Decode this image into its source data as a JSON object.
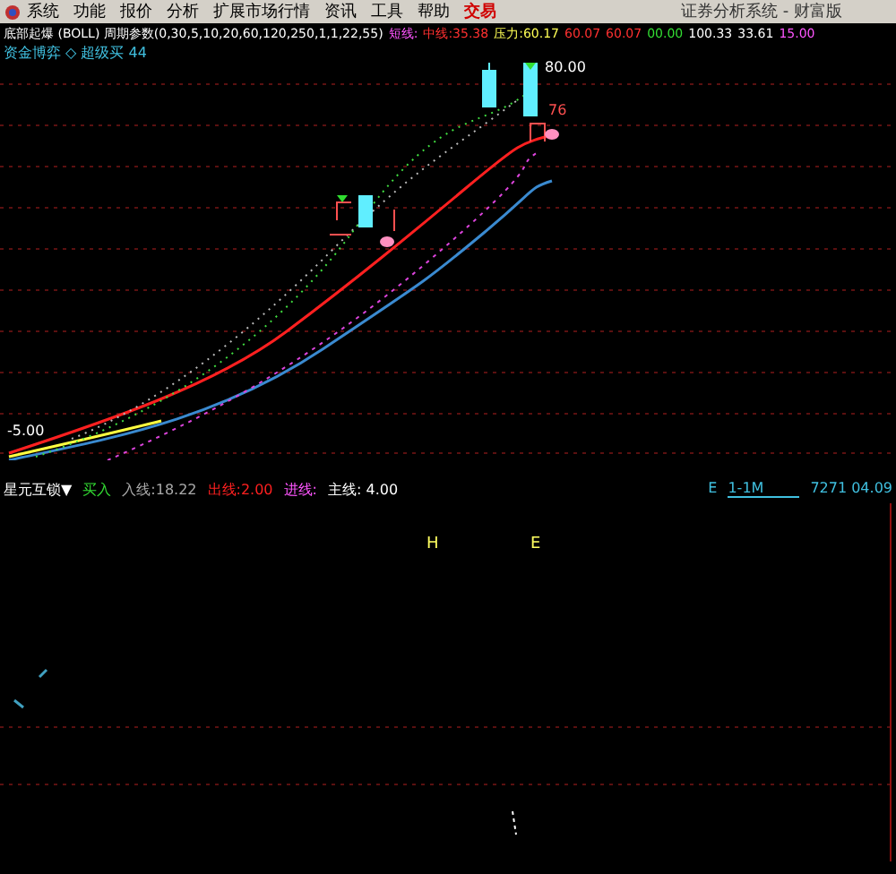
{
  "menu": {
    "items": [
      {
        "label": "系统",
        "highlight": false
      },
      {
        "label": "功能",
        "highlight": false
      },
      {
        "label": "报价",
        "highlight": false
      },
      {
        "label": "分析",
        "highlight": false
      },
      {
        "label": "扩展市场行情",
        "highlight": false
      },
      {
        "label": "资讯",
        "highlight": false
      },
      {
        "label": "工具",
        "highlight": false
      },
      {
        "label": "帮助",
        "highlight": false
      },
      {
        "label": "交易",
        "highlight": true
      }
    ],
    "title": "证券分析系统 - 财富版"
  },
  "main_panel": {
    "legend": [
      {
        "text": "底部起爆 (BOLL) 周期参数(0,30,5,10,20,60,120,250,1,1,22,55)",
        "color": "#ffffff"
      },
      {
        "text": "短线:",
        "color": "#ff55ff"
      },
      {
        "text": "中线:35.38",
        "color": "#ff3030"
      },
      {
        "text": "压力:60.17",
        "color": "#ffff55"
      },
      {
        "text": "60.07",
        "color": "#ff3030"
      },
      {
        "text": "60.07",
        "color": "#ff3030"
      },
      {
        "text": "00.00",
        "color": "#33dd33"
      },
      {
        "text": "100.33",
        "color": "#ffffff"
      },
      {
        "text": "33.61",
        "color": "#ffffff"
      },
      {
        "text": "15.00",
        "color": "#ff55ff"
      }
    ],
    "sub_legend": "资金博弈 ◇ 超级买 44",
    "labels": [
      {
        "text": "80.00",
        "kind": "high"
      },
      {
        "text": "76",
        "kind": "last"
      },
      {
        "text": "-5.00",
        "kind": "low"
      }
    ]
  },
  "lower_panel": {
    "legend": [
      {
        "text": "星元互锁▼",
        "color": "#ffffff"
      },
      {
        "text": "买入",
        "color": "#33dd33"
      },
      {
        "text": "入线:18.22",
        "color": "#aaaaaa"
      },
      {
        "text": "出线:2.00",
        "color": "#ff2020"
      },
      {
        "text": "进线:",
        "color": "#ff55ff"
      },
      {
        "text": "主线: 4.00",
        "color": "#ffffff"
      }
    ],
    "period": {
      "label": "E",
      "value": "1-1M",
      "date": "7271 04.09"
    },
    "marks": [
      {
        "text": "H"
      },
      {
        "text": "E"
      }
    ]
  }
}
